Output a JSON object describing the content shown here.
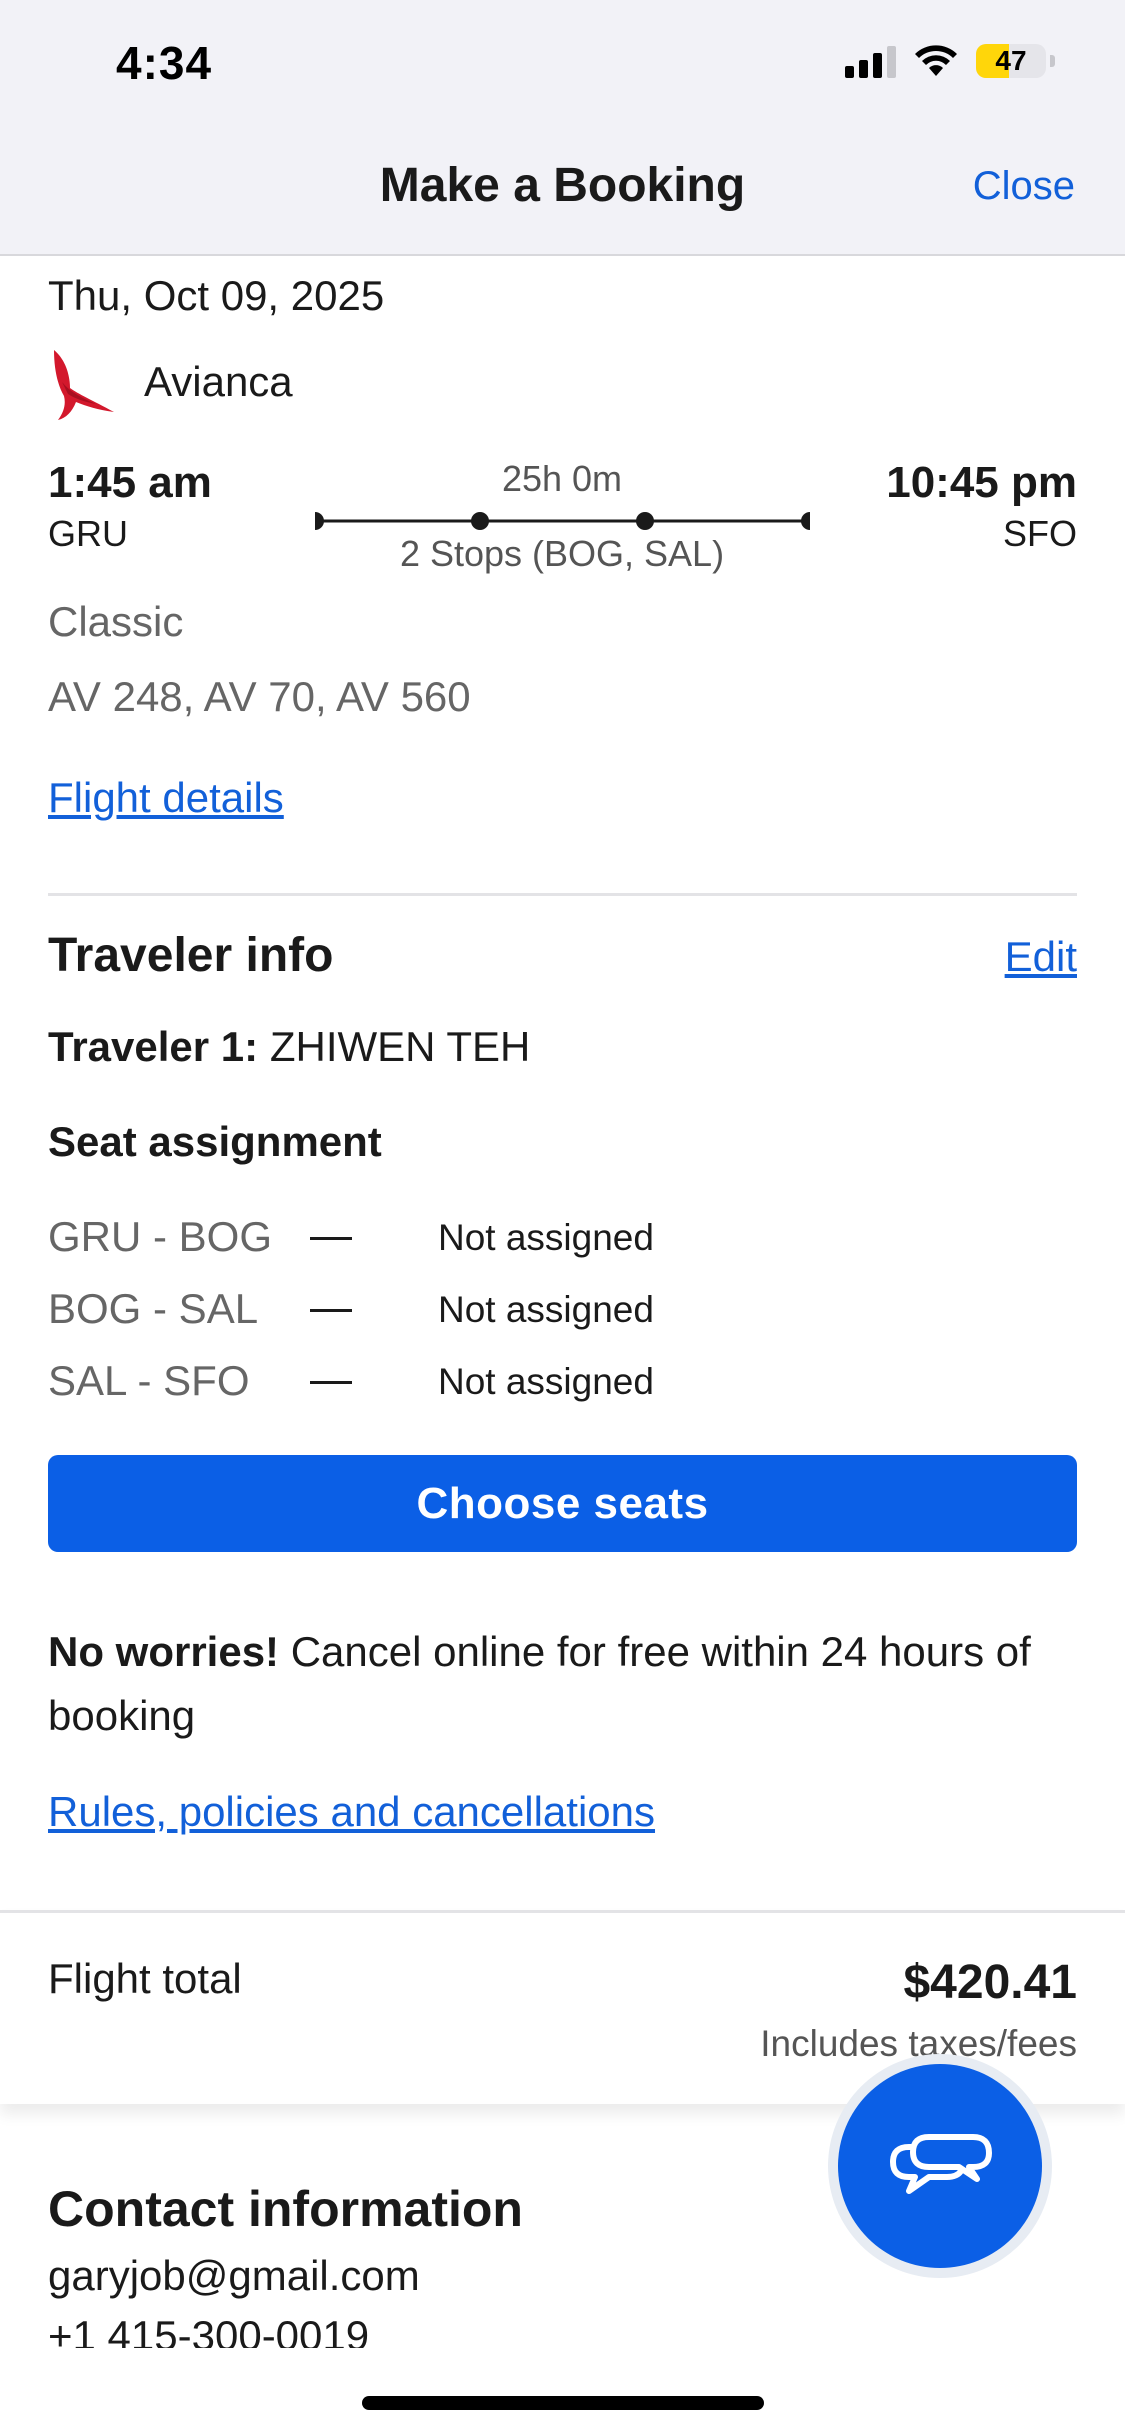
{
  "status_bar": {
    "time": "4:34",
    "battery": "47",
    "battery_level": 0.47,
    "battery_color": "#ffd60a"
  },
  "header": {
    "title": "Make a Booking",
    "close_label": "Close"
  },
  "flight": {
    "date": "Thu, Oct 09, 2025",
    "airline": "Avianca",
    "airline_logo_icon": "avianca-bird-icon",
    "departure_time": "1:45 am",
    "departure_code": "GRU",
    "arrival_time": "10:45 pm",
    "arrival_code": "SFO",
    "duration": "25h 0m",
    "stops": "2 Stops (BOG, SAL)",
    "fare_class": "Classic",
    "flight_numbers": "AV 248, AV 70, AV 560",
    "details_link": "Flight details"
  },
  "traveler": {
    "section_title": "Traveler info",
    "edit_label": "Edit",
    "label": "Traveler 1:",
    "name": "ZHIWEN TEH",
    "seat_title": "Seat assignment",
    "seats": [
      {
        "route": "GRU - BOG",
        "status": "Not assigned"
      },
      {
        "route": "BOG - SAL",
        "status": "Not assigned"
      },
      {
        "route": "SAL - SFO",
        "status": "Not assigned"
      }
    ],
    "choose_seats_label": "Choose seats"
  },
  "cancellation": {
    "bold": "No worries!",
    "text": " Cancel online for free within 24 hours of booking",
    "rules_link": "Rules, policies and cancellations"
  },
  "total": {
    "label": "Flight total",
    "amount": "$420.41",
    "note": "Includes taxes/fees"
  },
  "contact": {
    "title": "Contact information",
    "email": "garyjob@gmail.com",
    "phone": "+1 415-300-0019"
  },
  "chat": {
    "icon": "chat-bubbles-icon"
  },
  "colors": {
    "accent": "#0b5fe6",
    "link": "#1260d9"
  }
}
